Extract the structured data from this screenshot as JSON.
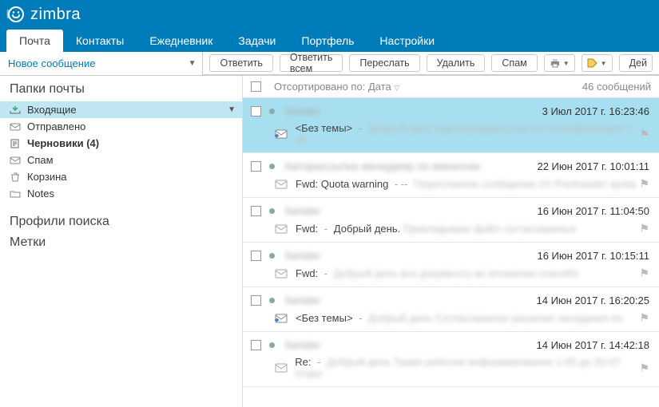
{
  "brand": "zimbra",
  "nav": {
    "tabs": [
      {
        "label": "Почта",
        "active": true
      },
      {
        "label": "Контакты"
      },
      {
        "label": "Ежедневник"
      },
      {
        "label": "Задачи"
      },
      {
        "label": "Портфель"
      },
      {
        "label": "Настройки"
      }
    ]
  },
  "compose_label": "Новое сообщение",
  "toolbar": {
    "reply": "Ответить",
    "reply_all": "Ответить всем",
    "forward": "Переслать",
    "delete": "Удалить",
    "spam": "Спам",
    "actions_partial": "Дей"
  },
  "sidebar": {
    "mail_folders_header": "Папки почты",
    "folders": [
      {
        "label": "Входящие",
        "selected": true,
        "dd": true
      },
      {
        "label": "Отправлено"
      },
      {
        "label": "Черновики (4)",
        "bold": true
      },
      {
        "label": "Спам"
      },
      {
        "label": "Корзина"
      },
      {
        "label": "Notes"
      }
    ],
    "search_profiles": "Профили поиска",
    "labels": "Метки"
  },
  "listheader": {
    "sort_prefix": "Отсортировано по:",
    "sort_field": "Дата",
    "count": "46 сообщений"
  },
  "messages": [
    {
      "date": "3 Июл 2017 г. 16:23:46",
      "subject": "<Без темы>",
      "selected": true,
      "forwarded": true
    },
    {
      "date": "22 Июн 2017 г. 10:01:11",
      "subject": "Fwd: Quota warning"
    },
    {
      "date": "16 Июн 2017 г. 11:04:50",
      "subject": "Fwd:",
      "snippet": "Добрый день."
    },
    {
      "date": "16 Июн 2017 г. 10:15:11",
      "subject": "Fwd:"
    },
    {
      "date": "14 Июн 2017 г. 16:20:25",
      "subject": "<Без темы>",
      "forwarded": true
    },
    {
      "date": "14 Июн 2017 г. 14:42:18",
      "subject": "Re:"
    }
  ]
}
